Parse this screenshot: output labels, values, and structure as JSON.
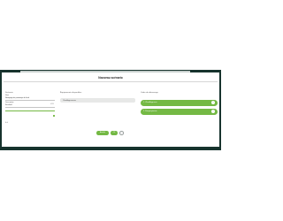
{
  "modal": {
    "title": "Nouveau scénario"
  },
  "left_panel": {
    "header": "Scénario",
    "name_label": "Nom",
    "name_value": "Nettoyage de printemps de fond",
    "desc_label": "Description",
    "desc_value": "Facultatif",
    "hint": "0/255",
    "checkbox_label": "Actif"
  },
  "middle_panel": {
    "header": "Équipements disponibles",
    "pill_text": "Chauffage-eau-ec"
  },
  "right_panel": {
    "header": "Ordre de démarrage",
    "items": [
      {
        "label": "1. Chauffage-eau"
      },
      {
        "label": "2. Pompe-piscine"
      }
    ]
  },
  "footer": {
    "cancel_label": "Annuler",
    "ok_label": "OK",
    "more_label": "⋯"
  },
  "colors": {
    "accent": "#74b944",
    "backdrop": "#17332d",
    "pill": "#e7e8e7"
  }
}
